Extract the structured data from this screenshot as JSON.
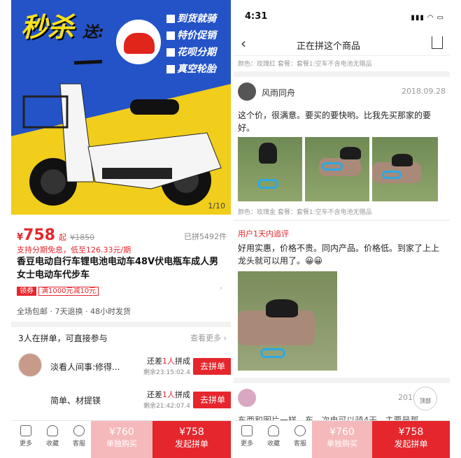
{
  "left": {
    "hero": {
      "promo": "秒杀",
      "send": "送:",
      "features": [
        "到货就骑",
        "特价促销",
        "花呗分期",
        "真空轮胎"
      ],
      "counter": "1/10"
    },
    "price": {
      "symbol": "¥",
      "value": "758",
      "suffix": "起",
      "original": "¥1850",
      "sold": "已拼5492件"
    },
    "installment": "支持分期免息，低至126.33元/期",
    "title": "香豆电动自行车锂电池电动车48V伏电瓶车成人男女士电动车代步车",
    "coupon": {
      "tag": "领券",
      "text": "满1000元减10元"
    },
    "services": "全场包邮 · 7天退换 · 48小时发货",
    "group": {
      "header": "3人在拼单，可直接参与",
      "more": "查看更多 ›",
      "rows": [
        {
          "name": "淡看人间事:修得...",
          "need_pre": "还差",
          "need_num": "1人",
          "need_post": "拼成",
          "remain": "剩余23:15:02.4",
          "button": "去拼单"
        },
        {
          "name": "简单、材提镁",
          "need_pre": "还差",
          "need_num": "1人",
          "need_post": "拼成",
          "remain": "剩余21:42:07.4",
          "button": "去拼单"
        }
      ]
    },
    "bottom": {
      "more": "更多",
      "fav": "收藏",
      "service": "客服",
      "single_price": "¥760",
      "single_label": "单独购买",
      "group_price": "¥758",
      "group_label": "发起拼单"
    }
  },
  "right": {
    "status_time": "4:31",
    "nav_title": "正在拼这个商品",
    "meta1": "颜色：玫瑰红   套餐：套餐1:空车不含电池无赠品",
    "review1": {
      "name": "风雨同舟",
      "date": "2018.09.28",
      "text": "这个价，很满意。要买的要快哟。比我先买那家的要好。",
      "meta": "颜色：玫瑰金   套餐：套餐1:空车不含电池无赠品"
    },
    "review2": {
      "tag": "用户1天内追评",
      "text": "好用实惠，价格不贵。同内产品。价格低。到家了上上龙头就可以用了。😀😀"
    },
    "review3": {
      "date": "2018",
      "text": "东西和图片一样，东...次电可以骑4天...主要是那"
    },
    "top_label": "顶部",
    "bottom": {
      "more": "更多",
      "fav": "收藏",
      "service": "客服",
      "single_price": "¥760",
      "single_label": "单独购买",
      "group_price": "¥758",
      "group_label": "发起拼单"
    }
  }
}
